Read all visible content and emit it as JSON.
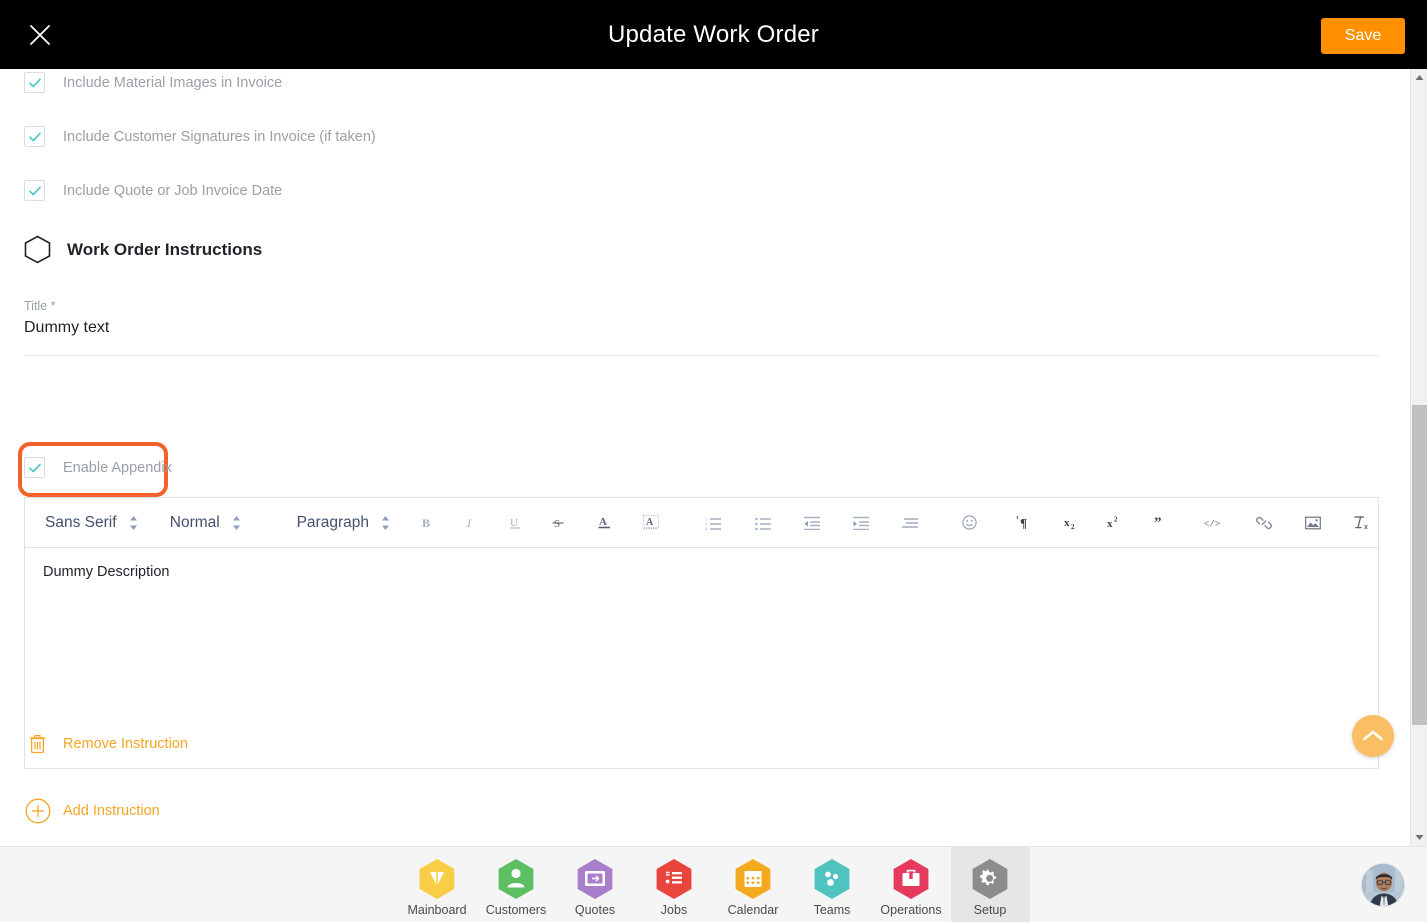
{
  "header": {
    "title": "Update Work Order",
    "close_icon": "close-icon",
    "save_label": "Save",
    "save_color": "#FF9100"
  },
  "checkboxes": [
    {
      "label": "Include Material Images in Invoice",
      "checked": true
    },
    {
      "label": "Include Customer Signatures in Invoice (if taken)",
      "checked": true
    },
    {
      "label": "Include Quote or Job Invoice Date",
      "checked": true
    }
  ],
  "section": {
    "icon": "hexagon-icon",
    "title": "Work Order Instructions"
  },
  "title_field": {
    "label": "Title *",
    "value": "Dummy text"
  },
  "appendix": {
    "label": "Enable Appendix",
    "checked": true,
    "highlight_color": "#F2622A"
  },
  "editor": {
    "font_family_select": "Sans Serif",
    "font_size_select": "Normal",
    "block_format_select": "Paragraph",
    "buttons": [
      {
        "name": "bold-icon",
        "glyph": "B"
      },
      {
        "name": "italic-icon",
        "glyph": "I"
      },
      {
        "name": "underline-icon",
        "glyph": "U"
      },
      {
        "name": "strikethrough-icon",
        "glyph": "S"
      },
      {
        "name": "text-color-icon",
        "glyph": "A"
      },
      {
        "name": "background-color-icon",
        "glyph": "A"
      },
      {
        "name": "ordered-list-icon",
        "glyph": ""
      },
      {
        "name": "unordered-list-icon",
        "glyph": ""
      },
      {
        "name": "outdent-icon",
        "glyph": ""
      },
      {
        "name": "indent-icon",
        "glyph": ""
      },
      {
        "name": "align-icon",
        "glyph": ""
      },
      {
        "name": "emoji-icon",
        "glyph": ""
      },
      {
        "name": "text-direction-icon",
        "glyph": ""
      },
      {
        "name": "subscript-icon",
        "glyph": "x2"
      },
      {
        "name": "superscript-icon",
        "glyph": "x2"
      },
      {
        "name": "blockquote-icon",
        "glyph": ""
      },
      {
        "name": "code-block-icon",
        "glyph": "</>"
      },
      {
        "name": "link-icon",
        "glyph": ""
      },
      {
        "name": "image-icon",
        "glyph": ""
      },
      {
        "name": "clear-formatting-icon",
        "glyph": ""
      }
    ],
    "body_text": "Dummy Description"
  },
  "actions": {
    "remove": {
      "label": "Remove Instruction",
      "icon": "trash-icon"
    },
    "add": {
      "label": "Add Instruction",
      "icon": "plus-circle-icon"
    },
    "color": "#F5A623"
  },
  "scroll_top_button": {
    "icon": "chevron-up-icon",
    "color": "#FBBF63"
  },
  "scrollbar": {
    "up_icon": "triangle-up-icon",
    "down_icon": "triangle-down-icon"
  },
  "bottom_nav": {
    "items": [
      {
        "label": "Mainboard",
        "icon": "mainboard-icon",
        "color": "#F8CE46",
        "active": false
      },
      {
        "label": "Customers",
        "icon": "customers-icon",
        "color": "#5DBE62",
        "active": false
      },
      {
        "label": "Quotes",
        "icon": "quotes-icon",
        "color": "#A97FCB",
        "active": false
      },
      {
        "label": "Jobs",
        "icon": "jobs-icon",
        "color": "#E8453C",
        "active": false
      },
      {
        "label": "Calendar",
        "icon": "calendar-icon",
        "color": "#F4A91E",
        "active": false
      },
      {
        "label": "Teams",
        "icon": "teams-icon",
        "color": "#4FC3C0",
        "active": false
      },
      {
        "label": "Operations",
        "icon": "operations-icon",
        "color": "#E53A5E",
        "active": false
      },
      {
        "label": "Setup",
        "icon": "gear-icon",
        "color": "#8C8C8C",
        "active": true
      }
    ],
    "avatar": "user-avatar"
  }
}
